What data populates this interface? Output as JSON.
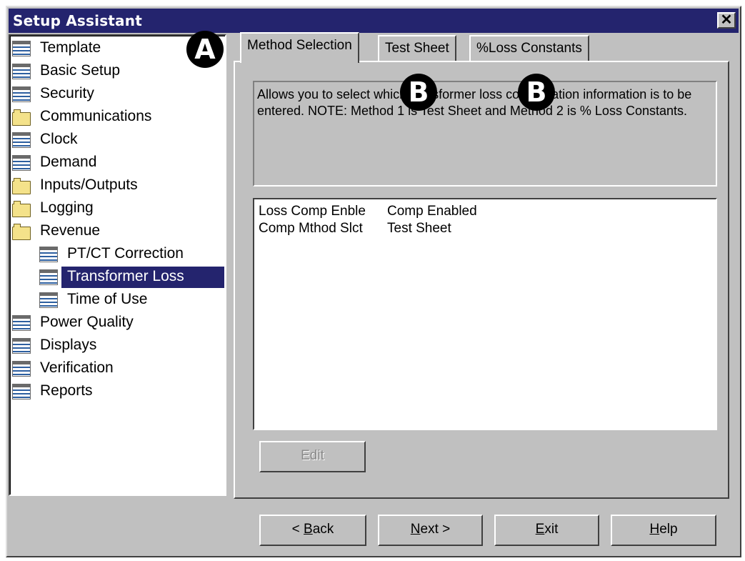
{
  "window": {
    "title": "Setup Assistant",
    "close_label": "✕"
  },
  "tree": {
    "items": [
      {
        "label": "Template",
        "icon": "document-icon",
        "level": 0,
        "selected": false
      },
      {
        "label": "Basic Setup",
        "icon": "document-icon",
        "level": 0,
        "selected": false
      },
      {
        "label": "Security",
        "icon": "document-icon",
        "level": 0,
        "selected": false
      },
      {
        "label": "Communications",
        "icon": "folder-icon",
        "level": 0,
        "selected": false
      },
      {
        "label": "Clock",
        "icon": "document-icon",
        "level": 0,
        "selected": false
      },
      {
        "label": "Demand",
        "icon": "document-icon",
        "level": 0,
        "selected": false
      },
      {
        "label": "Inputs/Outputs",
        "icon": "folder-icon",
        "level": 0,
        "selected": false
      },
      {
        "label": "Logging",
        "icon": "folder-icon",
        "level": 0,
        "selected": false
      },
      {
        "label": "Revenue",
        "icon": "folder-icon",
        "level": 0,
        "selected": false
      },
      {
        "label": "PT/CT Correction",
        "icon": "document-icon",
        "level": 1,
        "selected": false
      },
      {
        "label": "Transformer Loss",
        "icon": "document-icon",
        "level": 1,
        "selected": true
      },
      {
        "label": "Time of Use",
        "icon": "document-icon",
        "level": 1,
        "selected": false
      },
      {
        "label": "Power Quality",
        "icon": "document-icon",
        "level": 0,
        "selected": false
      },
      {
        "label": "Displays",
        "icon": "document-icon",
        "level": 0,
        "selected": false
      },
      {
        "label": "Verification",
        "icon": "document-icon",
        "level": 0,
        "selected": false
      },
      {
        "label": "Reports",
        "icon": "document-icon",
        "level": 0,
        "selected": false
      }
    ]
  },
  "tabs": [
    {
      "label": "Method Selection",
      "active": true
    },
    {
      "label": "Test Sheet",
      "active": false
    },
    {
      "label": "%Loss Constants",
      "active": false
    }
  ],
  "description": "Allows you to select which transformer loss configuration information is to be entered. NOTE: Method 1 is Test Sheet and Method 2 is % Loss Constants.",
  "settings": [
    {
      "key": "Loss Comp Enble",
      "value": "Comp Enabled"
    },
    {
      "key": "Comp Mthod Slct",
      "value": "Test Sheet"
    }
  ],
  "buttons": {
    "edit": "Edit",
    "back_pre": "< ",
    "back_key": "B",
    "back_post": "ack",
    "next_key": "N",
    "next_post": "ext >",
    "exit_key": "E",
    "exit_post": "xit",
    "help_key": "H",
    "help_post": "elp"
  },
  "callouts": {
    "a": "A",
    "b": "B"
  },
  "colors": {
    "titlebar": "#24246e",
    "selection": "#24246e",
    "face": "#c0c0c0"
  }
}
